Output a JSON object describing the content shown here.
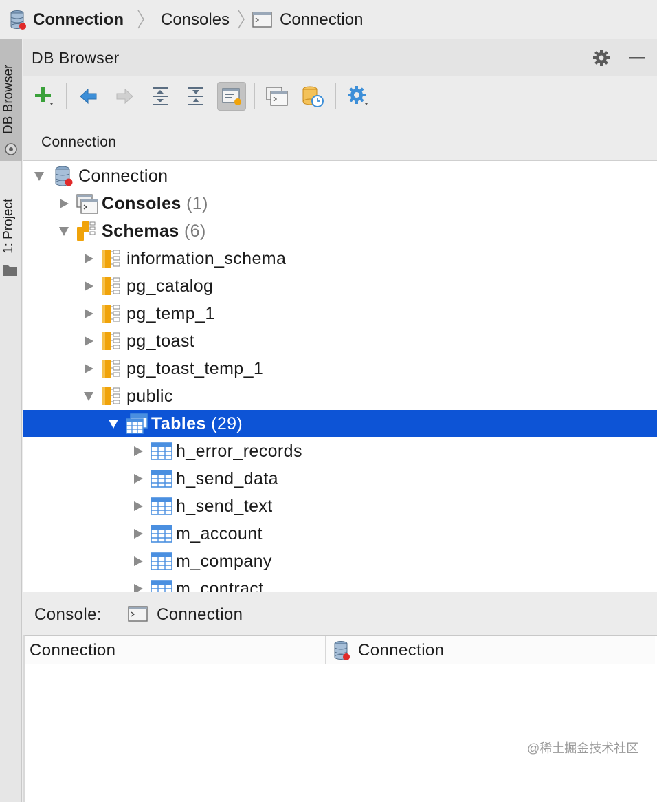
{
  "breadcrumb": {
    "items": [
      {
        "label": "Connection",
        "icon": "database-icon"
      },
      {
        "label": "Consoles"
      },
      {
        "label": "Connection",
        "icon": "console-icon"
      }
    ]
  },
  "side_tabs": {
    "db_browser": "DB Browser",
    "project": "1: Project"
  },
  "panel": {
    "title": "DB Browser",
    "connection_label": "Connection"
  },
  "toolbar": {
    "buttons": [
      "add-icon",
      "back-icon",
      "forward-icon",
      "expand-all-icon",
      "collapse-all-icon",
      "object-properties-icon",
      "open-console-icon",
      "database-history-icon",
      "settings-icon"
    ]
  },
  "tree": {
    "rows": [
      {
        "label": "Connection",
        "count": "",
        "bold": false,
        "expanded": true,
        "type": "connection"
      },
      {
        "label": "Consoles",
        "count": "(1)",
        "bold": true,
        "expanded": false,
        "type": "consoles"
      },
      {
        "label": "Schemas",
        "count": "(6)",
        "bold": true,
        "expanded": true,
        "type": "schemas"
      },
      {
        "label": "information_schema",
        "count": "",
        "bold": false,
        "expanded": false,
        "type": "schema"
      },
      {
        "label": "pg_catalog",
        "count": "",
        "bold": false,
        "expanded": false,
        "type": "schema"
      },
      {
        "label": "pg_temp_1",
        "count": "",
        "bold": false,
        "expanded": false,
        "type": "schema"
      },
      {
        "label": "pg_toast",
        "count": "",
        "bold": false,
        "expanded": false,
        "type": "schema"
      },
      {
        "label": "pg_toast_temp_1",
        "count": "",
        "bold": false,
        "expanded": false,
        "type": "schema"
      },
      {
        "label": "public",
        "count": "",
        "bold": false,
        "expanded": true,
        "type": "schema"
      },
      {
        "label": "Tables",
        "count": "(29)",
        "bold": true,
        "expanded": true,
        "type": "tables",
        "selected": true
      },
      {
        "label": "h_error_records",
        "count": "",
        "bold": false,
        "expanded": false,
        "type": "table"
      },
      {
        "label": "h_send_data",
        "count": "",
        "bold": false,
        "expanded": false,
        "type": "table"
      },
      {
        "label": "h_send_text",
        "count": "",
        "bold": false,
        "expanded": false,
        "type": "table"
      },
      {
        "label": "m_account",
        "count": "",
        "bold": false,
        "expanded": false,
        "type": "table"
      },
      {
        "label": "m_company",
        "count": "",
        "bold": false,
        "expanded": false,
        "type": "table"
      },
      {
        "label": "m_contract",
        "count": "",
        "bold": false,
        "expanded": false,
        "type": "table"
      }
    ]
  },
  "console": {
    "label": "Console:",
    "name": "Connection",
    "columns": [
      "Connection",
      "Connection"
    ]
  },
  "watermark": "@稀土掘金技术社区",
  "colors": {
    "selection": "#0d54d6",
    "schema_orange": "#f0a30a",
    "table_blue": "#4a8fe0",
    "add_green": "#3aa13a",
    "nav_blue": "#3d8fd8"
  }
}
